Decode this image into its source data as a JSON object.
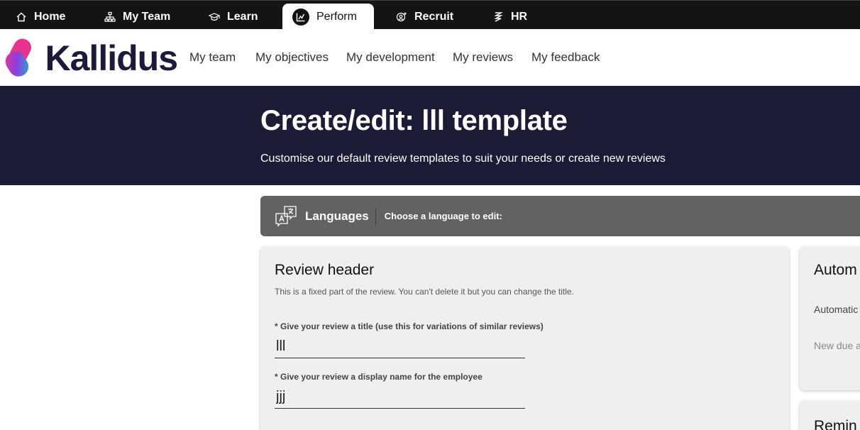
{
  "topbar": {
    "tabs": [
      {
        "label": "Home",
        "icon": "home-icon"
      },
      {
        "label": "My Team",
        "icon": "org-chart-icon"
      },
      {
        "label": "Learn",
        "icon": "graduation-cap-icon"
      },
      {
        "label": "Perform",
        "icon": "performance-chart-icon",
        "active": true
      },
      {
        "label": "Recruit",
        "icon": "recruit-icon"
      },
      {
        "label": "HR",
        "icon": "hr-icon"
      }
    ]
  },
  "brand": {
    "name": "Kallidus",
    "colors": {
      "pink": "#e6338f",
      "purple": "#7b3fe4",
      "teal": "#1fb5c9",
      "navy": "#1b1a3a"
    }
  },
  "subnav": {
    "links": [
      "My team",
      "My objectives",
      "My development",
      "My reviews",
      "My feedback"
    ]
  },
  "hero": {
    "title": "Create/edit: lll template",
    "subtitle": "Customise our default review templates to suit your needs or create new reviews"
  },
  "languages": {
    "title": "Languages",
    "hint": "Choose a language to edit:"
  },
  "review_header": {
    "title": "Review header",
    "description": "This is a fixed part of the review. You can't delete it but you can change the title.",
    "title_field": {
      "label": "* Give your review a title (use this for variations of similar reviews)",
      "value": "lll"
    },
    "display_field": {
      "label": "* Give your review a display name for the employee",
      "value": "jjj"
    }
  },
  "automation_card": {
    "title": "Autom",
    "text": "Automatic when the",
    "muted_text": "New due after:"
  },
  "reminder_card": {
    "title": "Remin"
  }
}
